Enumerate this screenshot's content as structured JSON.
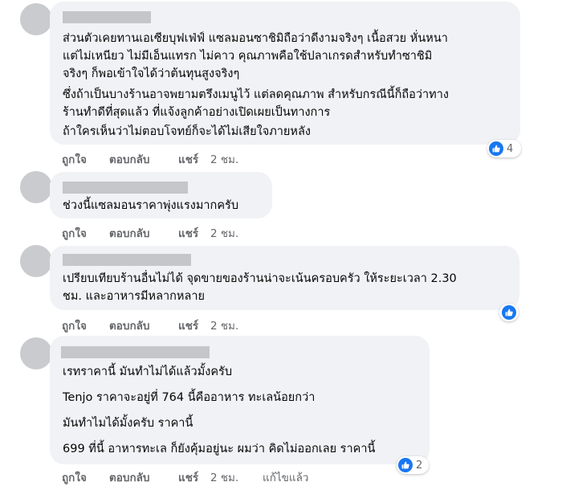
{
  "colors": {
    "bubble": "#f0f2f5",
    "text": "#050505",
    "muted": "#65676b",
    "like_blue": "#1877f2",
    "avatar": "#c9cbcf",
    "redacted_name": "#c4c6ca"
  },
  "comments": [
    {
      "lines": [
        "ส่วนตัวเคยทานเอเซียบุฟเฟ่ฟ์ แซลมอนซาชิมิถือว่าดีงามจริงๆ เนื้อสวย หั่นหนา",
        "แต่ไม่เหนียว ไม่มีเอ็นแทรก ไม่คาว คุณภาพคือใช้ปลาเกรดสำหรับทำซาชิมิ",
        "จริงๆ ก็พอเข้าใจได้ว่าต้นทุนสูงจริงๆ",
        "ซึ่งถ้าเป็นบางร้านอาจพยามตรึงเมนูไว้ แต่ลดคุณภาพ สำหรับกรณีนี้ก็ถือว่าทาง",
        "ร้านทำดีที่สุดแล้ว ที่แจ้งลูกค้าอย่างเปิดเผยเป็นทางการ",
        "ถ้าใครเห็นว่าไม่ตอบโจทย์ก็จะได้ไม่เสียใจภายหลัง"
      ],
      "actions": {
        "like": "ถูกใจ",
        "reply": "ตอบกลับ",
        "share": "แชร์",
        "time": "2 ชม."
      },
      "reaction_icon": "thumbs-up-icon",
      "reaction_count": "4"
    },
    {
      "lines": [
        "ช่วงนี้แซลมอนราคาพุ่งแรงมากครับ"
      ],
      "actions": {
        "like": "ถูกใจ",
        "reply": "ตอบกลับ",
        "share": "แชร์",
        "time": "2 ชม."
      }
    },
    {
      "lines": [
        "เปรียบเทียบร้านอื่นไม่ได้ จุดขายของร้านน่าจะเน้นครอบครัว ให้ระยะเวลา 2.30",
        "ชม. และอาหารมีหลากหลาย"
      ],
      "actions": {
        "like": "ถูกใจ",
        "reply": "ตอบกลับ",
        "share": "แชร์",
        "time": "2 ชม."
      },
      "reaction_icon": "thumbs-up-icon"
    },
    {
      "lines": [
        "เรทราคานี้ มันทำไม่ได้แล้วมั้งครับ",
        "Tenjo ราคาจะอยู่ที่ 764 นี้คืออาหาร ทะเลน้อยกว่า",
        "มันทำไมได้มั้งครับ ราคานี้",
        "699 ที่นี้ อาหารทะเล ก็ยังคุ้มอยู่นะ ผมว่า คิดไม่ออกเลย ราคานี้"
      ],
      "actions": {
        "like": "ถูกใจ",
        "reply": "ตอบกลับ",
        "share": "แชร์",
        "time": "2 ชม.",
        "edited": "แก้ไขแล้ว"
      },
      "reaction_icon": "thumbs-up-icon",
      "reaction_count": "2"
    }
  ]
}
